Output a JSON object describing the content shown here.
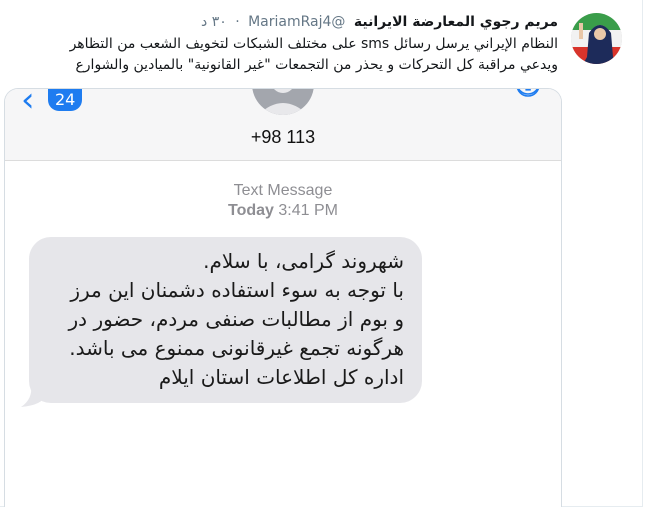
{
  "tweet": {
    "author_name": "مريم رجوي المعارضة الايرانية",
    "handle": "@MariamRaj4",
    "time": "٣٠ د",
    "text_line1": "النظام الإيراني يرسل رسائل sms على مختلف الشبكات لتخويف الشعب من التظاهر",
    "text_line2": "ويدعي مراقبة كل التحركات و يحذر من التجمعات \"غير القانونية\" بالميادين والشوارع"
  },
  "sms": {
    "badge_count": "24",
    "phone_number": "+98 113",
    "meta_title": "Text Message",
    "meta_day": "Today",
    "meta_time": "3:41 PM",
    "message_lines": [
      "شهروند گرامی، با سلام.",
      "با توجه به سوء استفاده دشمنان این مرز",
      "و بوم از مطالبات صنفی مردم، حضور در",
      "هرگونه تجمع غیرقانونی ممنوع می باشد.",
      "اداره کل اطلاعات استان ایلام"
    ]
  },
  "colors": {
    "ios_blue": "#1e7cf0",
    "bubble_gray": "#e6e6ea",
    "meta_gray": "#8e8e93",
    "secondary_text": "#657786"
  }
}
